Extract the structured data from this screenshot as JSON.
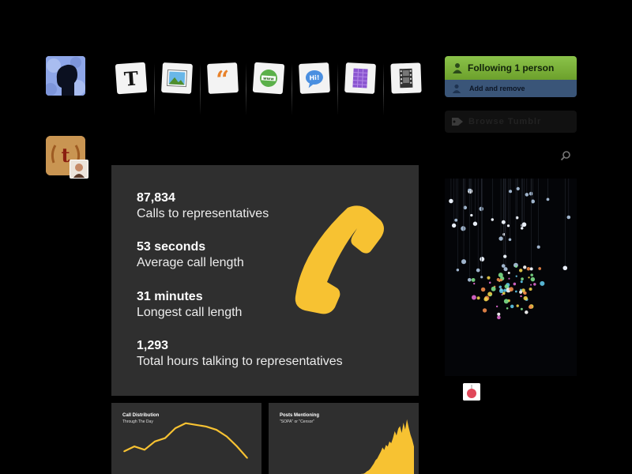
{
  "sidebar": {
    "follow_label": "Following 1 person",
    "add_remove_label": "Add and remove",
    "tags_label": "Browse Tumblr"
  },
  "post_types": [
    {
      "name": "text",
      "icon": "text-post-icon"
    },
    {
      "name": "photo",
      "icon": "photo-post-icon"
    },
    {
      "name": "quote",
      "icon": "quote-post-icon"
    },
    {
      "name": "link",
      "icon": "link-post-icon"
    },
    {
      "name": "chat",
      "icon": "chat-post-icon"
    },
    {
      "name": "audio",
      "icon": "audio-post-icon"
    },
    {
      "name": "video",
      "icon": "video-post-icon"
    }
  ],
  "post": {
    "stats": [
      {
        "value": "87,834",
        "label": "Calls to representatives"
      },
      {
        "value": "53 seconds",
        "label": "Average call length"
      },
      {
        "value": "31 minutes",
        "label": "Longest call length"
      },
      {
        "value": "1,293",
        "label": "Total hours talking to representatives"
      }
    ],
    "accent": "#f7c232"
  },
  "chart_data": [
    {
      "type": "line",
      "title": "Call Distribution",
      "subtitle": "Through The Day",
      "values": [
        12,
        18,
        14,
        24,
        28,
        40,
        46,
        44,
        42,
        38,
        30,
        18,
        4
      ],
      "color": "#f7c232"
    },
    {
      "type": "area",
      "title": "Posts Mentioning",
      "subtitle": "\"SOPA\" or \"Censor\"",
      "values": [
        0,
        0,
        0,
        0,
        0,
        0,
        0,
        0,
        0,
        0,
        0,
        0,
        0,
        0,
        0,
        0,
        1,
        2,
        2,
        3,
        5,
        6,
        8,
        11,
        14,
        18,
        20,
        24,
        28,
        33,
        30,
        36,
        34,
        40,
        38,
        44,
        52,
        47,
        55,
        58,
        50,
        62,
        54,
        66,
        56,
        48,
        42,
        34
      ],
      "color": "#f7c232"
    }
  ]
}
